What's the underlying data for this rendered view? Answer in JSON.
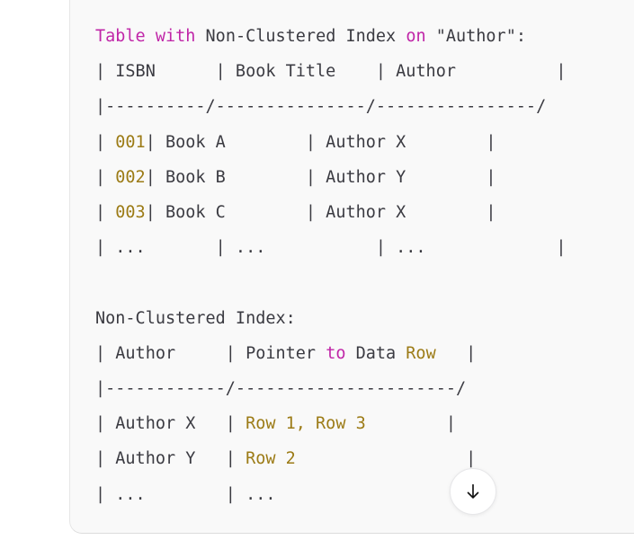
{
  "panel": {
    "name": "assistant-code-block",
    "background": "#f9f9f9",
    "accent_keyword_color": "#c026a8",
    "accent_number_color": "#9c7b16",
    "separator_color": "#9a9aa1",
    "text_color": "#3b3b42"
  },
  "code": {
    "section1": {
      "heading": {
        "kw1": "Table",
        "kw2": "with",
        "text1": "Non-Clustered Index",
        "kw3": "on",
        "text2": "\"Author\":"
      },
      "header_row": "| ISBN      | Book Title    | Author          |",
      "separator_row": "|----------/---------------/----------------/",
      "rows": [
        {
          "isbn": "001",
          "rest": "| Book A        | Author X        |"
        },
        {
          "isbn": "002",
          "rest": "| Book B        | Author Y        |"
        },
        {
          "isbn": "003",
          "rest": "| Book C        | Author X        |"
        }
      ],
      "ellipsis_row": "| ...       | ...           | ...             |"
    },
    "section2": {
      "title": "Non-Clustered Index:",
      "header_row_prefix": "| Author     | Pointer ",
      "header_kw": "to",
      "header_mid": " Data ",
      "header_num": "Row",
      "header_suffix": "   |",
      "separator_row": "|------------/----------------------/",
      "rows": [
        {
          "author": "| Author X   | ",
          "pointer": "Row 1, Row 3",
          "suffix": "        |"
        },
        {
          "author": "| Author Y   | ",
          "pointer": "Row 2",
          "suffix": "                 |"
        },
        {
          "author": "| ...        | ",
          "pointer": "...",
          "suffix": "                   |"
        }
      ]
    }
  },
  "scroll_button": {
    "label": "scroll-to-bottom",
    "glyph": "↓"
  }
}
